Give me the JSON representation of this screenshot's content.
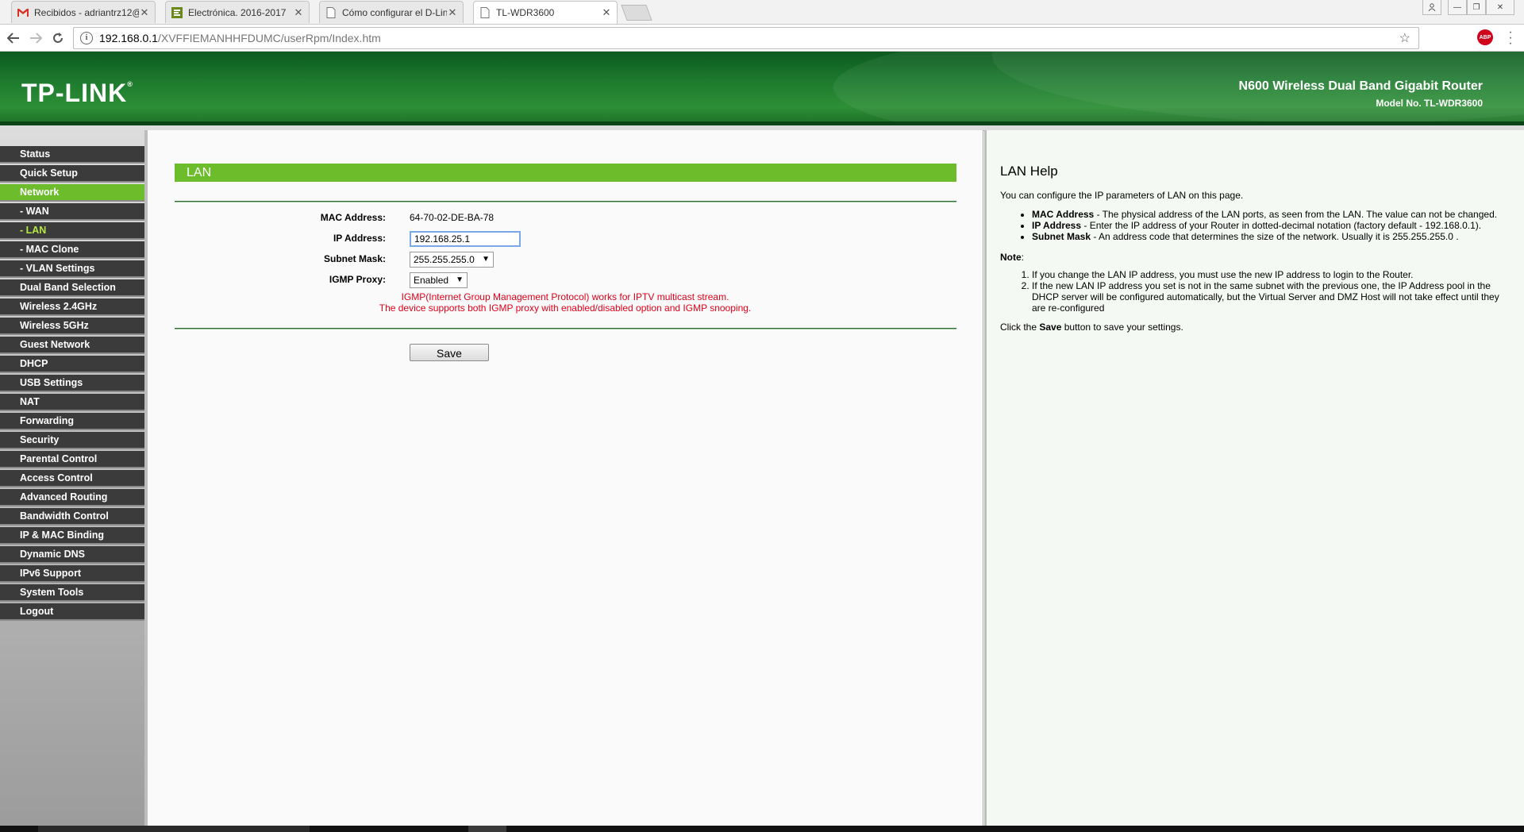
{
  "browser": {
    "tabs": [
      {
        "label": "Recibidos - adriantrz12@",
        "icon": "gmail-icon"
      },
      {
        "label": "Electrónica. 2016-2017",
        "icon": "site-icon"
      },
      {
        "label": "Cómo configurar el D-Lin",
        "icon": "page-icon"
      },
      {
        "label": "TL-WDR3600",
        "icon": "page-icon"
      }
    ],
    "url_host": "192.168.0.1",
    "url_path": "/XVFFIEMANHHFDUMC/userRpm/Index.htm",
    "abp_label": "ABP"
  },
  "banner": {
    "logo": "TP-LINK",
    "product": "N600 Wireless Dual Band Gigabit Router",
    "model": "Model No. TL-WDR3600"
  },
  "sidebar": {
    "items": [
      {
        "label": "Status"
      },
      {
        "label": "Quick Setup"
      },
      {
        "label": "Network"
      },
      {
        "label": "- WAN"
      },
      {
        "label": "- LAN"
      },
      {
        "label": "- MAC Clone"
      },
      {
        "label": "- VLAN Settings"
      },
      {
        "label": "Dual Band Selection"
      },
      {
        "label": "Wireless 2.4GHz"
      },
      {
        "label": "Wireless 5GHz"
      },
      {
        "label": "Guest Network"
      },
      {
        "label": "DHCP"
      },
      {
        "label": "USB Settings"
      },
      {
        "label": "NAT"
      },
      {
        "label": "Forwarding"
      },
      {
        "label": "Security"
      },
      {
        "label": "Parental Control"
      },
      {
        "label": "Access Control"
      },
      {
        "label": "Advanced Routing"
      },
      {
        "label": "Bandwidth Control"
      },
      {
        "label": "IP & MAC Binding"
      },
      {
        "label": "Dynamic DNS"
      },
      {
        "label": "IPv6 Support"
      },
      {
        "label": "System Tools"
      },
      {
        "label": "Logout"
      }
    ]
  },
  "main": {
    "title": "LAN",
    "mac_label": "MAC Address:",
    "mac_value": "64-70-02-DE-BA-78",
    "ip_label": "IP Address:",
    "ip_value": "192.168.25.1",
    "mask_label": "Subnet Mask:",
    "mask_value": "255.255.255.0",
    "igmp_label": "IGMP Proxy:",
    "igmp_value": "Enabled",
    "note1": "IGMP(Internet Group Management Protocol) works for IPTV multicast stream.",
    "note2": "The device supports both IGMP proxy with enabled/disabled option and IGMP snooping.",
    "save_label": "Save"
  },
  "help": {
    "title": "LAN Help",
    "intro": "You can configure the IP parameters of LAN on this page.",
    "items": [
      {
        "term": "MAC Address",
        "text": " - The physical address of the LAN ports, as seen from the LAN. The value can not be changed."
      },
      {
        "term": "IP Address",
        "text": " - Enter the IP address of your Router in dotted-decimal notation (factory default - 192.168.0.1)."
      },
      {
        "term": "Subnet Mask",
        "text": " - An address code that determines the size of the network. Usually it is 255.255.255.0 ."
      }
    ],
    "note_title": "Note",
    "note_colon": ":",
    "notes": [
      "If you change the LAN IP address, you must use the new IP address to login to the Router.",
      "If the new LAN IP address you set is not in the same subnet with the previous one, the IP Address pool in the DHCP server will be configured automatically, but the Virtual Server and DMZ Host will not take effect until they are re-configured"
    ],
    "save_pre": "Click the ",
    "save_term": "Save",
    "save_post": " button to save your settings."
  },
  "colors": {
    "accent_green": "#6cbc2c",
    "nav_dark": "#3b3b3b",
    "note_red": "#e0001a"
  }
}
